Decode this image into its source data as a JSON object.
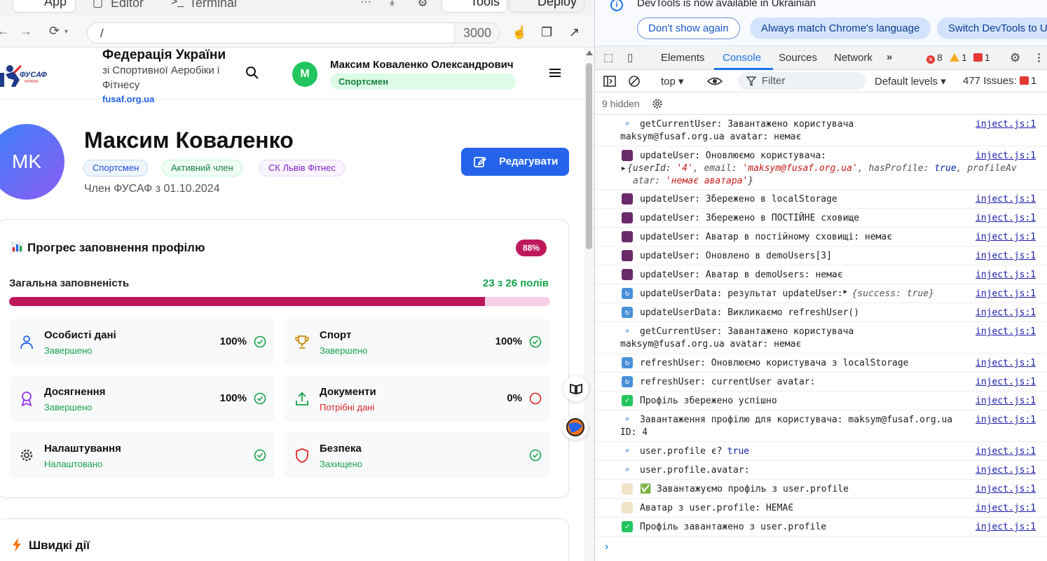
{
  "app_bar": {
    "app_label": "App",
    "editor_label": "Editor",
    "terminal_label": "Terminal",
    "more_label": "···",
    "tools_label": "Tools",
    "deploy_label": "Deploy"
  },
  "address_bar": {
    "path": "/",
    "port": "3000"
  },
  "site_header": {
    "org_name": "Федерація України",
    "org_subtitle": "зі Спортивної Аеробіки і Фітнесу",
    "org_link": "fusaf.org.ua",
    "logo_text": "ФУСАФ",
    "logo_subtext": "УКРАЇНА",
    "user_initial": "M",
    "user_name": "Максим Коваленко Олександрович",
    "user_role": "Спортсмен"
  },
  "profile": {
    "initials": "MK",
    "name": "Максим Коваленко",
    "tags": [
      "Спортсмен",
      "Активний член",
      "СК Львів Фітнес"
    ],
    "member_since": "Член ФУСАФ з 01.10.2024",
    "edit_label": "Редагувати"
  },
  "progress": {
    "title": "Прогрес заповнення профілю",
    "badge": "88%",
    "overall_label": "Загальна заповненість",
    "overall_count": "23 з 26 полів",
    "fill_fraction": 0.88,
    "sections": [
      {
        "name": "Особисті дані",
        "status": "Завершено",
        "percent": "100%",
        "icon": "user-icon",
        "color": "#2563eb",
        "state": "done"
      },
      {
        "name": "Спорт",
        "status": "Завершено",
        "percent": "100%",
        "icon": "trophy-icon",
        "color": "#ca8a04",
        "state": "done"
      },
      {
        "name": "Досягнення",
        "status": "Завершено",
        "percent": "100%",
        "icon": "award-icon",
        "color": "#9333ea",
        "state": "done"
      },
      {
        "name": "Документи",
        "status": "Потрібні дані",
        "percent": "0%",
        "icon": "upload-icon",
        "color": "#16a34a",
        "state": "missing"
      },
      {
        "name": "Налаштування",
        "status": "Налаштовано",
        "percent": "",
        "icon": "gear-icon",
        "color": "#444444",
        "state": "done"
      },
      {
        "name": "Безпека",
        "status": "Захищено",
        "percent": "",
        "icon": "shield-icon",
        "color": "#dc2626",
        "state": "done"
      }
    ]
  },
  "quick_actions": {
    "title": "Швидкі дії"
  },
  "devtools": {
    "info_text": "DevTools is now available in Ukrainian",
    "btn_dont_show": "Don't show again",
    "btn_match": "Always match Chrome's language",
    "btn_switch": "Switch DevTools to U",
    "tabs": [
      "Elements",
      "Console",
      "Sources",
      "Network"
    ],
    "active_tab": "Console",
    "error_count": "8",
    "warning_count": "1",
    "issue_count": "1",
    "context": "top",
    "filter_placeholder": "Filter",
    "levels": "Default levels",
    "issues_label": "477 Issues:",
    "issues_count": "1",
    "hidden_label": "9 hidden",
    "source": "inject.js:1",
    "logs": [
      {
        "icon": "magnifier",
        "line1": "getCurrentUser: Завантажено користувача",
        "line2": "maksym@fusaf.org.ua avatar: немає"
      },
      {
        "icon": "floppy",
        "line1": "updateUser: Оновлюємо користувача:",
        "obj": true
      },
      {
        "icon": "floppy",
        "line1": "updateUser: Збережено в localStorage"
      },
      {
        "icon": "floppy",
        "line1": "updateUser: Збережено в ПОСТІЙНЕ сховище"
      },
      {
        "icon": "floppy",
        "line1": "updateUser: Аватар в постійному сховищі: немає"
      },
      {
        "icon": "floppy",
        "line1": "updateUser: Оновлено в demoUsers[3]"
      },
      {
        "icon": "floppy",
        "line1": "updateUser: Аватар в demoUsers: немає"
      },
      {
        "icon": "refresh",
        "line1": "updateUserData: результат updateUser:",
        "obj_inline": "{success: true}"
      },
      {
        "icon": "refresh",
        "line1": "updateUserData: Викликаємо refreshUser()"
      },
      {
        "icon": "magnifier",
        "line1": "getCurrentUser: Завантажено користувача",
        "line2": "maksym@fusaf.org.ua avatar: немає"
      },
      {
        "icon": "refresh",
        "line1": "refreshUser: Оновлюємо користувача з localStorage"
      },
      {
        "icon": "refresh",
        "line1": "refreshUser: currentUser avatar:"
      },
      {
        "icon": "check",
        "line1": "Профіль збережено успішно"
      },
      {
        "icon": "magnifier",
        "line1": "Завантаження профілю для користувача: maksym@fusaf.org.ua",
        "line2": "ID: 4"
      },
      {
        "icon": "magnifier",
        "line1": "user.profile є? ",
        "tail": "true"
      },
      {
        "icon": "magnifier",
        "line1": "user.profile.avatar:"
      },
      {
        "icon": "memo",
        "line1": "✅ Завантажуємо профіль з user.profile"
      },
      {
        "icon": "memo",
        "line1": "Аватар з user.profile: НЕМАЄ"
      },
      {
        "icon": "check",
        "line1": "Профіль завантажено з user.profile"
      }
    ],
    "update_obj": {
      "line1_parts": [
        "{userId: ",
        "'4'",
        ", email: ",
        "'maksym@fusaf.org.ua'",
        ", hasProfile: ",
        "true",
        ", profileAv"
      ],
      "line2_parts": [
        "atar: ",
        "'немає аватара'",
        "}"
      ]
    },
    "prompt": "›"
  }
}
